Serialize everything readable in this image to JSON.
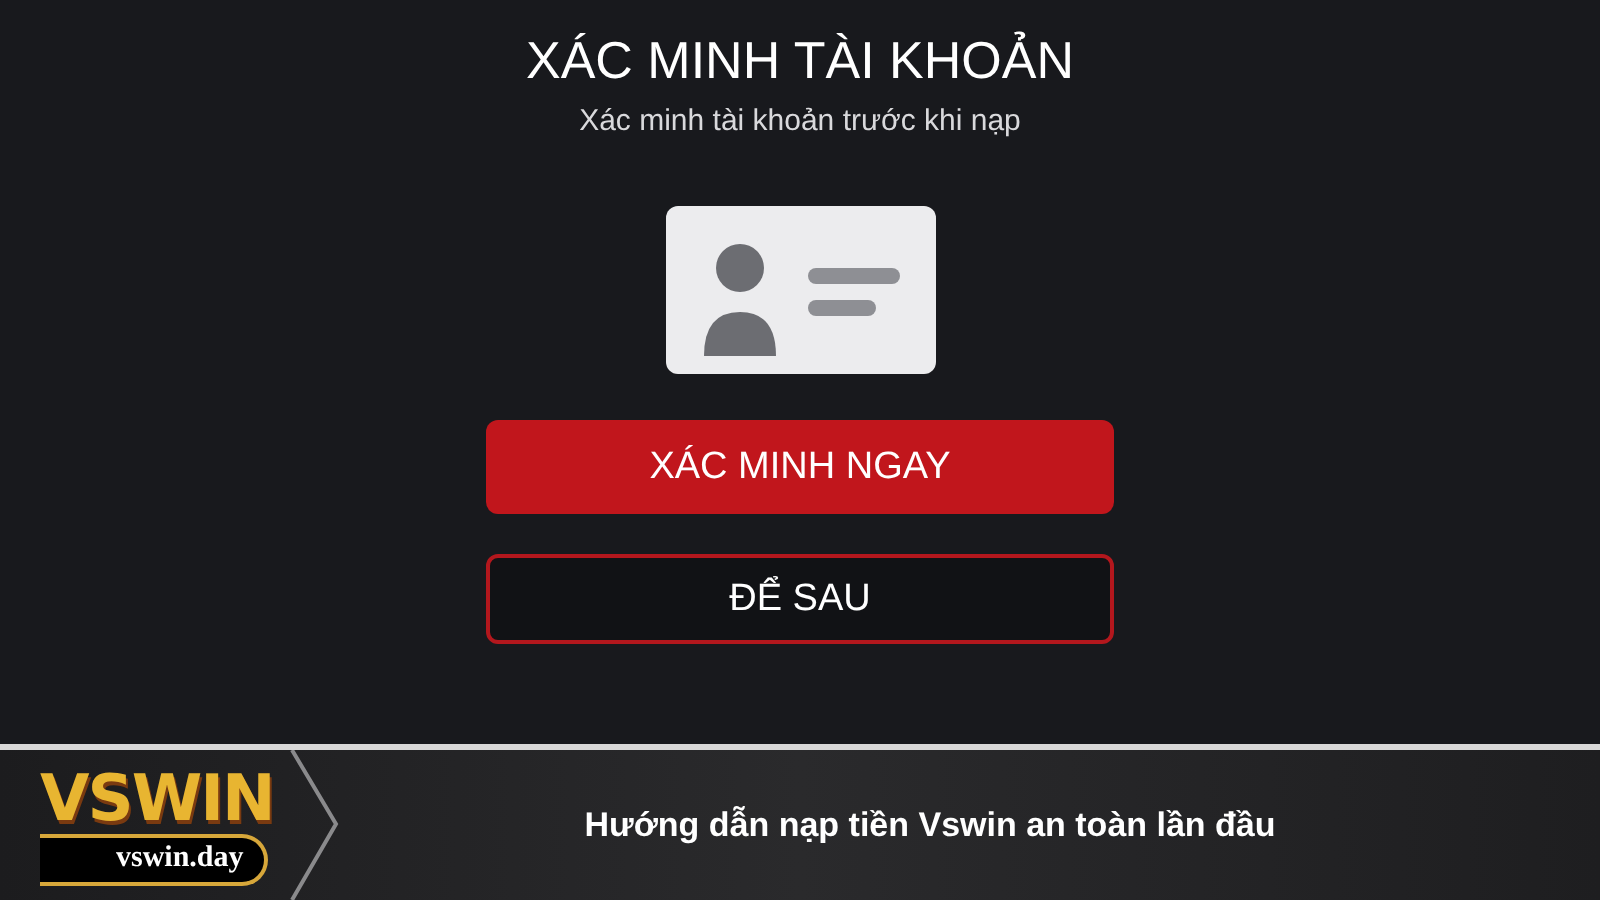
{
  "dialog": {
    "title": "XÁC MINH TÀI KHOẢN",
    "subtitle": "Xác minh tài khoản trước khi nạp",
    "buttons": [
      {
        "label": "XÁC MINH NGAY",
        "kind": "primary"
      },
      {
        "label": "ĐỂ SAU",
        "kind": "secondary"
      }
    ]
  },
  "banner": {
    "logo": "VSWIN",
    "domain": "vswin.day",
    "caption": "Hướng dẫn nạp tiền Vswin an toàn lần đầu"
  }
}
